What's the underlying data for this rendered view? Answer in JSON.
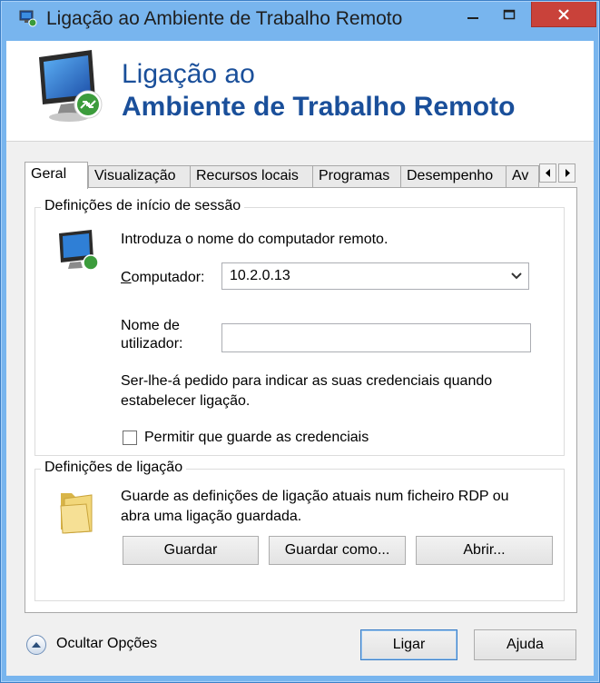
{
  "window": {
    "title": "Ligação ao Ambiente de Trabalho Remoto"
  },
  "banner": {
    "line1": "Ligação ao",
    "line2": "Ambiente de Trabalho Remoto"
  },
  "tabs": [
    {
      "label": "Geral",
      "active": true
    },
    {
      "label": "Visualização"
    },
    {
      "label": "Recursos locais"
    },
    {
      "label": "Programas"
    },
    {
      "label": "Desempenho"
    },
    {
      "label": "Av"
    }
  ],
  "logon": {
    "group_title": "Definições de início de sessão",
    "intro": "Introduza o nome do computador remoto.",
    "computer_label": "Computador:",
    "computer_value": "10.2.0.13",
    "username_label_1": "Nome de",
    "username_label_2": "utilizador:",
    "username_value": "",
    "note_line1": "Ser-lhe-á pedido para indicar as suas credenciais quando",
    "note_line2": "estabelecer ligação.",
    "save_credentials_label": "Permitir que guarde as credenciais",
    "save_credentials_checked": false
  },
  "connection": {
    "group_title": "Definições de ligação",
    "desc_line1": "Guarde as definições de ligação atuais num ficheiro RDP ou",
    "desc_line2": "abra uma ligação guardada.",
    "save_label": "Guardar",
    "save_as_label": "Guardar como...",
    "open_label": "Abrir..."
  },
  "footer": {
    "hide_options_label": "Ocultar Opções",
    "connect_label": "Ligar",
    "help_label": "Ajuda"
  },
  "colors": {
    "title_bar": "#78b5ee",
    "close_button": "#c9423a",
    "banner_text": "#1a4f9a"
  }
}
